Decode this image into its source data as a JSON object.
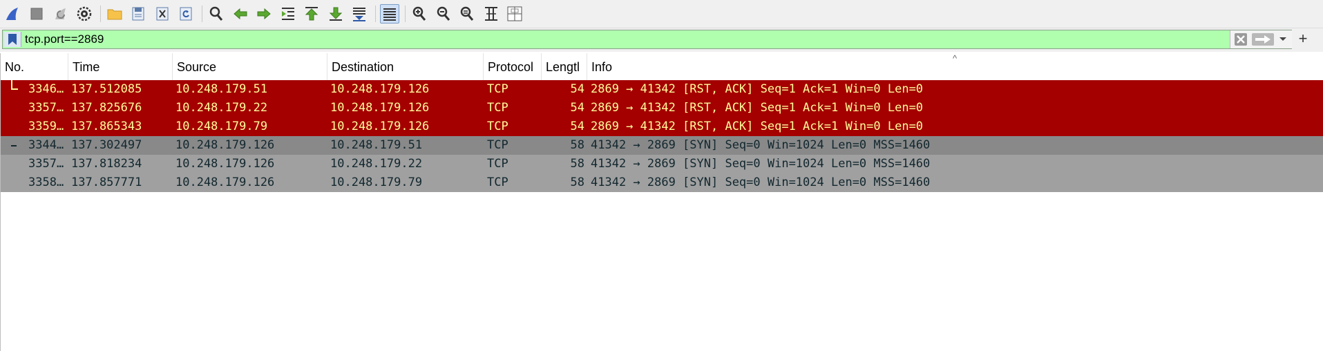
{
  "toolbar": {
    "buttons": [
      {
        "name": "start-capture-button",
        "icon": "shark-fin-icon"
      },
      {
        "name": "stop-capture-button",
        "icon": "stop-icon"
      },
      {
        "name": "restart-capture-button",
        "icon": "restart-icon"
      },
      {
        "name": "capture-options-button",
        "icon": "gear-icon"
      },
      {
        "name": "open-file-button",
        "icon": "folder-icon"
      },
      {
        "name": "save-file-button",
        "icon": "save-icon"
      },
      {
        "name": "close-file-button",
        "icon": "close-file-icon"
      },
      {
        "name": "reload-file-button",
        "icon": "reload-icon"
      },
      {
        "name": "find-packet-button",
        "icon": "magnifier-icon"
      },
      {
        "name": "go-back-button",
        "icon": "arrow-left-icon"
      },
      {
        "name": "go-forward-button",
        "icon": "arrow-right-icon"
      },
      {
        "name": "go-to-packet-button",
        "icon": "go-to-packet-icon"
      },
      {
        "name": "go-first-packet-button",
        "icon": "arrow-up-icon"
      },
      {
        "name": "go-last-packet-button",
        "icon": "arrow-down-icon"
      },
      {
        "name": "auto-scroll-button",
        "icon": "auto-scroll-icon"
      },
      {
        "name": "colorize-button",
        "icon": "colorize-icon"
      },
      {
        "name": "zoom-in-button",
        "icon": "zoom-in-icon"
      },
      {
        "name": "zoom-out-button",
        "icon": "zoom-out-icon"
      },
      {
        "name": "zoom-normal-button",
        "icon": "zoom-normal-icon"
      },
      {
        "name": "resize-columns-button",
        "icon": "resize-columns-icon"
      },
      {
        "name": "expand-subtrees-button",
        "icon": "expand-subtrees-icon"
      }
    ]
  },
  "filter": {
    "value": "tcp.port==2869",
    "background": "#afffaf"
  },
  "packet_list": {
    "columns": [
      "No.",
      "Time",
      "Source",
      "Destination",
      "Protocol",
      "Lengtl",
      "Info"
    ],
    "rows": [
      {
        "no": "3346…",
        "time": "137.512085",
        "src": "10.248.179.51",
        "dst": "10.248.179.126",
        "proto": "TCP",
        "len": "54",
        "info": "2869 → 41342 [RST, ACK] Seq=1 Ack=1 Win=0 Len=0",
        "style": "rst"
      },
      {
        "no": "3357…",
        "time": "137.825676",
        "src": "10.248.179.22",
        "dst": "10.248.179.126",
        "proto": "TCP",
        "len": "54",
        "info": "2869 → 41342 [RST, ACK] Seq=1 Ack=1 Win=0 Len=0",
        "style": "rst"
      },
      {
        "no": "3359…",
        "time": "137.865343",
        "src": "10.248.179.79",
        "dst": "10.248.179.126",
        "proto": "TCP",
        "len": "54",
        "info": "2869 → 41342 [RST, ACK] Seq=1 Ack=1 Win=0 Len=0",
        "style": "rst"
      },
      {
        "no": "3344…",
        "time": "137.302497",
        "src": "10.248.179.126",
        "dst": "10.248.179.51",
        "proto": "TCP",
        "len": "58",
        "info": "41342 → 2869 [SYN] Seq=0 Win=1024 Len=0 MSS=1460",
        "style": "syn"
      },
      {
        "no": "3357…",
        "time": "137.818234",
        "src": "10.248.179.126",
        "dst": "10.248.179.22",
        "proto": "TCP",
        "len": "58",
        "info": "41342 → 2869 [SYN] Seq=0 Win=1024 Len=0 MSS=1460",
        "style": "syn"
      },
      {
        "no": "3358…",
        "time": "137.857771",
        "src": "10.248.179.126",
        "dst": "10.248.179.79",
        "proto": "TCP",
        "len": "58",
        "info": "41342 → 2869 [SYN] Seq=0 Win=1024 Len=0 MSS=1460",
        "style": "syn"
      }
    ],
    "colors": {
      "rst_background": "#a40000",
      "rst_foreground": "#fffc9c",
      "syn_background": "#a0a0a0",
      "syn_foreground": "#12272e",
      "selected_background": "#898989"
    }
  }
}
